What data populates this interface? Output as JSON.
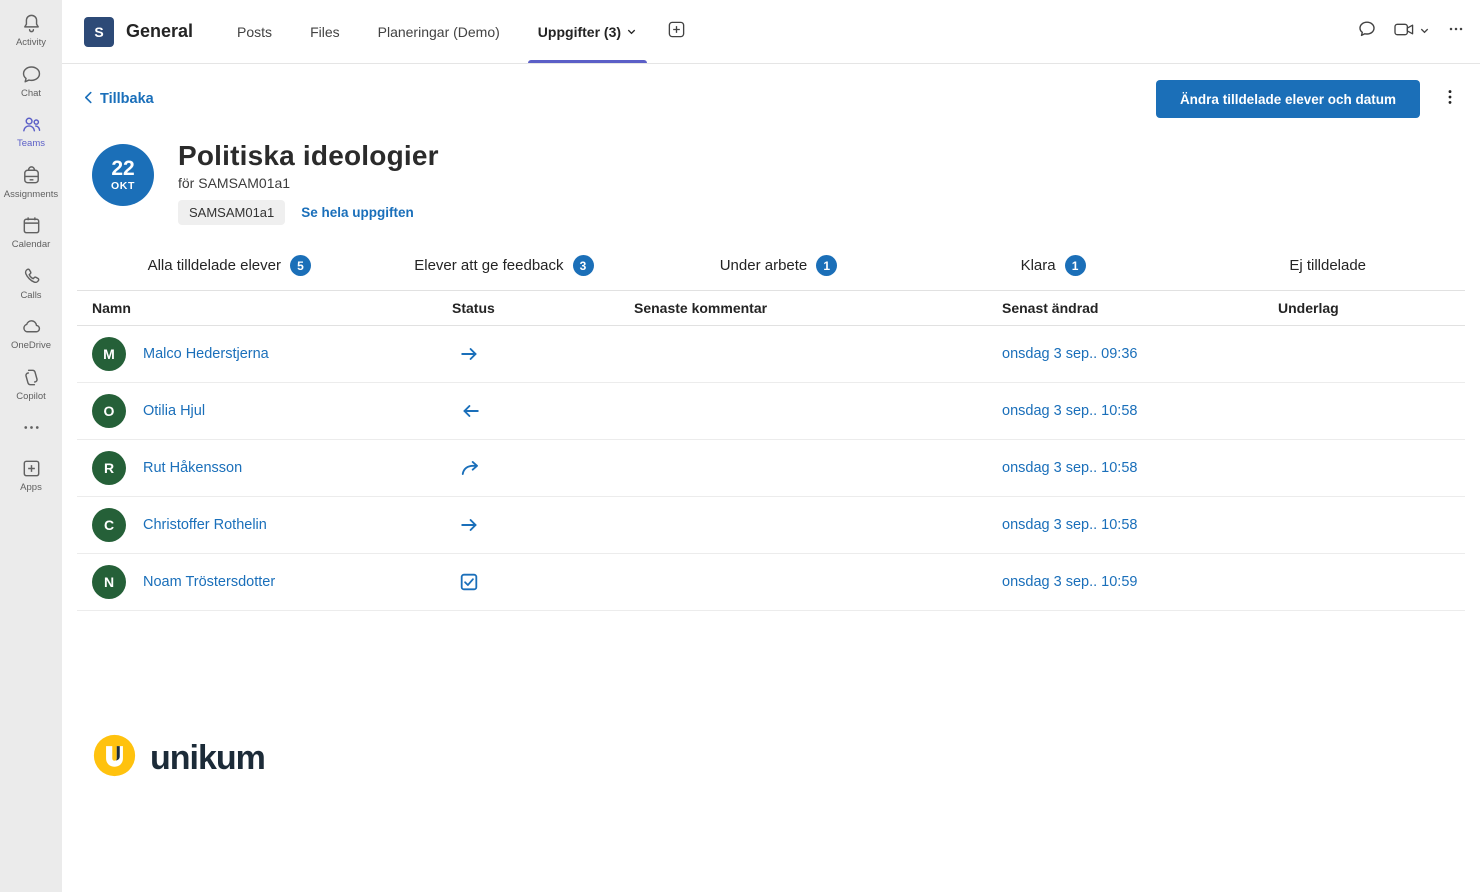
{
  "colors": {
    "teams_accent": "#5b5fc7",
    "app_blue": "#1b6fb8",
    "avatar_green": "#256038",
    "logo_yellow": "#ffc20e"
  },
  "sidebar": {
    "items": [
      {
        "label": "Activity",
        "icon": "bell-icon"
      },
      {
        "label": "Chat",
        "icon": "chat-icon"
      },
      {
        "label": "Teams",
        "icon": "people-icon"
      },
      {
        "label": "Assignments",
        "icon": "backpack-icon"
      },
      {
        "label": "Calendar",
        "icon": "calendar-icon"
      },
      {
        "label": "Calls",
        "icon": "phone-icon"
      },
      {
        "label": "OneDrive",
        "icon": "cloud-icon"
      },
      {
        "label": "Copilot",
        "icon": "copilot-icon"
      },
      {
        "label": "",
        "icon": "more-icon"
      },
      {
        "label": "Apps",
        "icon": "apps-icon"
      }
    ]
  },
  "header": {
    "team_initial": "S",
    "team_name": "General",
    "tabs": [
      {
        "label": "Posts"
      },
      {
        "label": "Files"
      },
      {
        "label": "Planeringar (Demo)"
      },
      {
        "label": "Uppgifter (3)"
      }
    ]
  },
  "toolbar": {
    "back_label": "Tillbaka",
    "primary_button": "Ändra tilldelade elever och datum"
  },
  "assignment": {
    "date_day": "22",
    "date_month": "OKT",
    "title": "Politiska ideologier",
    "subtitle": "för SAMSAM01a1",
    "tag": "SAMSAM01a1",
    "link": "Se hela uppgiften"
  },
  "filters": [
    {
      "label": "Alla tilldelade elever",
      "count": "5"
    },
    {
      "label": "Elever att ge feedback",
      "count": "3"
    },
    {
      "label": "Under arbete",
      "count": "1"
    },
    {
      "label": "Klara",
      "count": "1"
    },
    {
      "label": "Ej tilldelade",
      "count": ""
    }
  ],
  "table": {
    "headers": [
      "Namn",
      "Status",
      "Senaste kommentar",
      "Senast ändrad",
      "Underlag"
    ],
    "rows": [
      {
        "initial": "M",
        "name": "Malco Hederstjerna",
        "status": "arrow-right",
        "comment": "",
        "modified": "onsdag 3 sep.. 09:36",
        "underlag": ""
      },
      {
        "initial": "O",
        "name": "Otilia Hjul",
        "status": "arrow-left",
        "comment": "",
        "modified": "onsdag 3 sep.. 10:58",
        "underlag": ""
      },
      {
        "initial": "R",
        "name": "Rut Håkensson",
        "status": "arrow-forward",
        "comment": "",
        "modified": "onsdag 3 sep.. 10:58",
        "underlag": ""
      },
      {
        "initial": "C",
        "name": "Christoffer Rothelin",
        "status": "arrow-right",
        "comment": "",
        "modified": "onsdag 3 sep.. 10:58",
        "underlag": ""
      },
      {
        "initial": "N",
        "name": "Noam Tröstersdotter",
        "status": "check-square",
        "comment": "",
        "modified": "onsdag 3 sep.. 10:59",
        "underlag": ""
      }
    ]
  },
  "footer": {
    "logo_text": "unikum"
  }
}
